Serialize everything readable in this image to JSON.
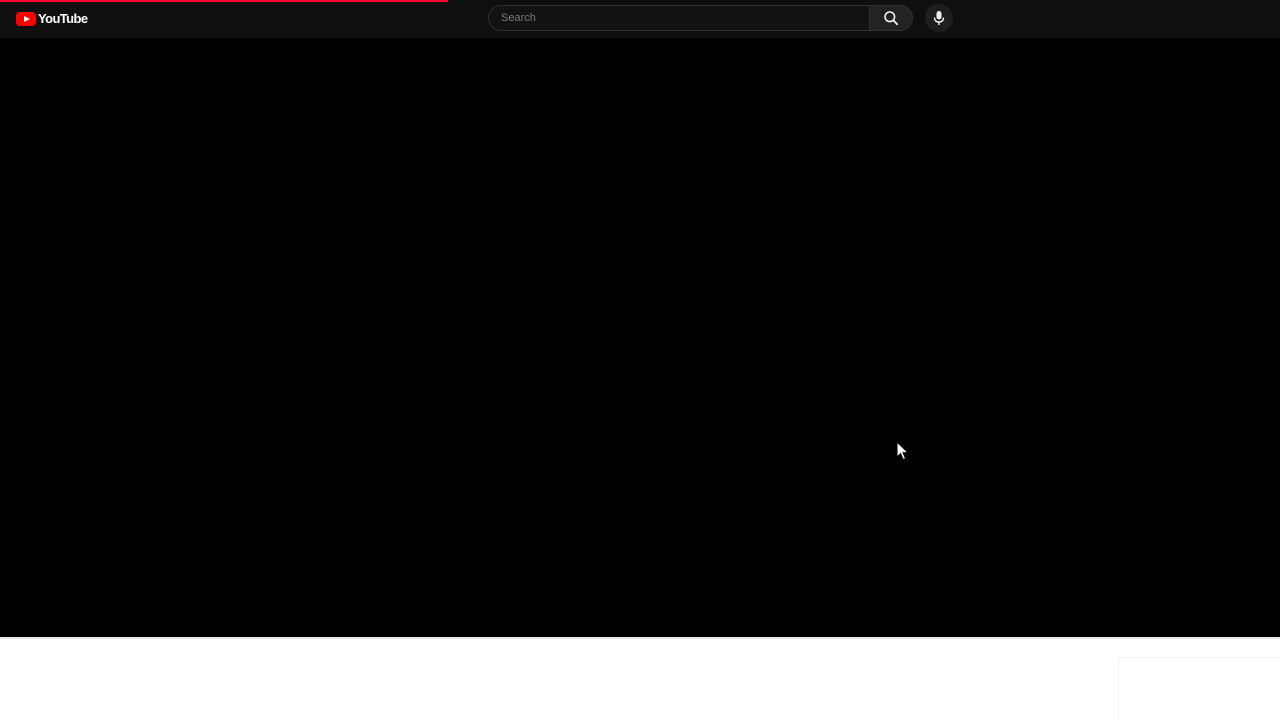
{
  "app": {
    "logo_text": "YouTube",
    "logo_icon": "youtube-play-icon"
  },
  "loading_bar": {
    "progress_percent": 35,
    "color": "#ff0033"
  },
  "search": {
    "placeholder": "Search",
    "value": "",
    "button_icon": "search-icon"
  },
  "voice_search": {
    "icon": "microphone-icon"
  },
  "player": {
    "state": "blank",
    "background": "#000000"
  },
  "cursor": {
    "icon": "mouse-pointer-icon"
  },
  "colors": {
    "masthead_bg": "#0f0f0f",
    "brand_red": "#ff0000",
    "page_bg": "#ffffff"
  }
}
